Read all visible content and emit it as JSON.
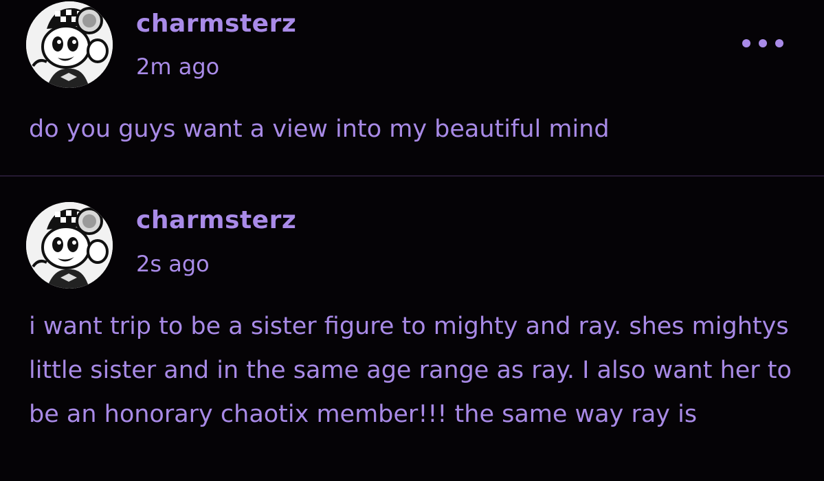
{
  "posts": [
    {
      "username": "charmsterz",
      "timestamp": "2m ago",
      "text": "do you guys want a view into my beautiful mind",
      "avatar_icon": "charmy-bee-avatar-icon",
      "menu_icon": "more-options-icon"
    },
    {
      "username": "charmsterz",
      "timestamp": "2s ago",
      "text": "i want trip to be a sister figure to mighty and ray. shes mightys little sister and in the same age range as ray. I also want her to be an honorary chaotix member!!! the same way ray is",
      "avatar_icon": "charmy-bee-avatar-icon"
    }
  ],
  "colors": {
    "background": "#050306",
    "accent": "#a98be8",
    "divider": "#261a33"
  }
}
